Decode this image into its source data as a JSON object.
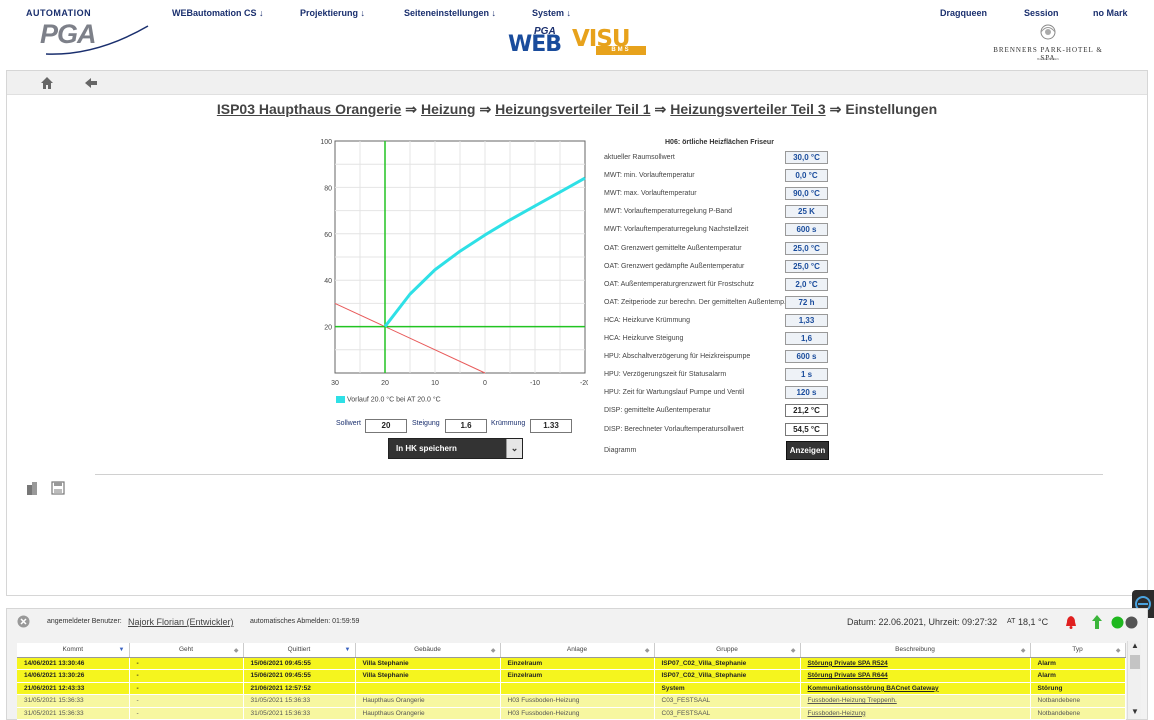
{
  "header": {
    "logo_top": "AUTOMATION",
    "logo_main": "PGA",
    "nav": [
      {
        "label": "WEBautomation CS ↓"
      },
      {
        "label": "Projektierung ↓"
      },
      {
        "label": "Seiteneinstellungen ↓"
      },
      {
        "label": "System ↓"
      }
    ],
    "center_logo": {
      "pga": "PGA",
      "web": "WEB",
      "visu": "VISU",
      "bms": "BMS"
    },
    "right_links": [
      {
        "label": "Dragqueen"
      },
      {
        "label": "Session"
      },
      {
        "label": "no Mark"
      }
    ],
    "hotel_name": "BRENNERS PARK-HOTEL & SPA",
    "hotel_sub": "BADEN-BADEN"
  },
  "toolbar": {
    "home_icon": "home-icon",
    "back_icon": "arrow-left-icon"
  },
  "breadcrumb": {
    "items": [
      "ISP03 Haupthaus Orangerie",
      "Heizung",
      "Heizungsverteiler Teil 1",
      "Heizungsverteiler Teil 3"
    ],
    "arrow": "⇒",
    "current": "Einstellungen"
  },
  "chart_data": {
    "type": "line",
    "x_ticks": [
      "30",
      "20",
      "10",
      "0",
      "-10",
      "-20"
    ],
    "y_ticks": [
      "100",
      "80",
      "60",
      "40",
      "20"
    ],
    "xlim": [
      30,
      -20
    ],
    "ylim": [
      0,
      100
    ],
    "grid": true,
    "series": [
      {
        "name": "Vorlauf 20.0 °C bei AT 20.0 °C",
        "color": "#2ee0e6",
        "x": [
          20,
          15,
          10,
          5,
          0,
          -5,
          -10,
          -15,
          -20
        ],
        "y": [
          20,
          34,
          44.5,
          52.5,
          59.5,
          66,
          72,
          78,
          84
        ]
      },
      {
        "name": "",
        "color": "#e85a5a",
        "x": [
          30,
          0
        ],
        "y": [
          30,
          0
        ]
      }
    ],
    "markers": {
      "vertical_x": 20,
      "horizontal_y": 20,
      "marker_color": "#22c422"
    },
    "legend": "Vorlauf 20.0 °C bei AT 20.0 °C"
  },
  "curve_params": {
    "sollwert_label": "Sollwert",
    "sollwert": "20",
    "steigung_label": "Steigung",
    "steigung": "1.6",
    "kruemmung_label": "Krümmung",
    "kruemmung": "1.33"
  },
  "save_dropdown": {
    "value": "In HK speichern",
    "caret": "⌄"
  },
  "settings": {
    "title": "H06: örtliche Heizflächen Friseur",
    "rows": [
      {
        "label": "aktueller Raumsollwert",
        "value": "30,0 °C"
      },
      {
        "label": "MWT: min. Vorlauftemperatur",
        "value": "0,0 °C"
      },
      {
        "label": "MWT: max. Vorlauftemperatur",
        "value": "90,0 °C"
      },
      {
        "label": "MWT: Vorlauftemperaturregelung P-Band",
        "value": "25 K"
      },
      {
        "label": "MWT: Vorlauftemperaturregelung Nachstellzeit",
        "value": "600 s"
      },
      {
        "label": "OAT: Grenzwert gemittelte Außentemperatur",
        "value": "25,0 °C"
      },
      {
        "label": "OAT: Grenzwert gedämpfte Außentemperatur",
        "value": "25,0 °C"
      },
      {
        "label": "OAT: Außentemperaturgrenzwert für Frostschutz",
        "value": "2,0 °C"
      },
      {
        "label": "OAT: Zeitperiode zur berechn. Der gemittelten Außentemp.",
        "value": "72 h"
      },
      {
        "label": "HCA: Heizkurve Krümmung",
        "value": "1,33"
      },
      {
        "label": "HCA: Heizkurve Steigung",
        "value": "1,6"
      },
      {
        "label": "HPU: Abschaltverzögerung für Heizkreispumpe",
        "value": "600 s"
      },
      {
        "label": "HPU: Verzögerungszeit für Statusalarm",
        "value": "1 s"
      },
      {
        "label": "HPU: Zeit für Wartungslauf Pumpe und Ventil",
        "value": "120 s"
      },
      {
        "label": "DISP: gemittelte Außentemperatur",
        "value": "21,2 °C"
      },
      {
        "label": "DISP: Berechneter Vorlauftemperatursollwert",
        "value": "54,5 °C"
      }
    ],
    "diagram_label": "Diagramm",
    "diagram_button": "Anzeigen"
  },
  "status_bar": {
    "user_prefix": "angemeldeter Benutzer:",
    "user": "Najork Florian (Entwickler)",
    "auto_logout": "automatisches Abmelden: 01:59:59",
    "datetime": "Datum: 22.06.2021, Uhrzeit: 09:27:32",
    "at_label": "AT",
    "at_value": "18,1 °C"
  },
  "alarm_table": {
    "headers": [
      "Kommt",
      "Geht",
      "Quittiert",
      "Gebäude",
      "Anlage",
      "Gruppe",
      "Beschreibung",
      "Typ"
    ],
    "rows": [
      [
        "14/06/2021 13:30:46",
        "-",
        "15/06/2021 09:45:55",
        "Villa Stephanie",
        "Einzelraum",
        "ISP07_C02_Villa_Stephanie",
        "Störung Private SPA R524",
        "Alarm"
      ],
      [
        "14/06/2021 13:30:26",
        "-",
        "15/06/2021 09:45:55",
        "Villa Stephanie",
        "Einzelraum",
        "ISP07_C02_Villa_Stephanie",
        "Störung Private SPA R644",
        "Alarm"
      ],
      [
        "21/06/2021 12:43:33",
        "-",
        "21/06/2021 12:57:52",
        "",
        "",
        "System",
        "Kommunikationsstörung BACnet Gateway",
        "Störung"
      ],
      [
        "31/05/2021 15:36:33",
        "-",
        "31/05/2021 15:36:33",
        "Haupthaus Orangerie",
        "H03 Fussboden-Heizung",
        "C03_FESTSAAL",
        "Fussboden-Heizung Treppenh.",
        "Notbandebene"
      ],
      [
        "31/05/2021 15:36:33",
        "-",
        "31/05/2021 15:36:33",
        "Haupthaus Orangerie",
        "H03 Fussboden-Heizung",
        "C03_FESTSAAL",
        "Fussboden-Heizung",
        "Notbandebene"
      ]
    ]
  }
}
